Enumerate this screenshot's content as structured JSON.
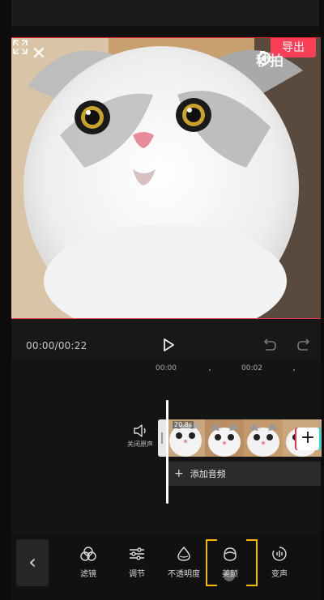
{
  "player": {
    "export_label": "导出",
    "watermark_text": "秒拍",
    "timecode": "00:00/00:22"
  },
  "timeline": {
    "ruler_labels": [
      "00:00",
      "00:02"
    ],
    "clip_duration": "20.8s",
    "mute_label": "关闭原声",
    "add_audio_label": "添加音频"
  },
  "toolbar": {
    "items": [
      {
        "label": "滤镜",
        "icon": "filter-icon"
      },
      {
        "label": "调节",
        "icon": "adjust-icon"
      },
      {
        "label": "不透明度",
        "icon": "opacity-icon"
      },
      {
        "label": "美颜",
        "icon": "beauty-icon"
      },
      {
        "label": "变声",
        "icon": "voice-change-icon"
      }
    ]
  },
  "colors": {
    "accent": "#fc3e57",
    "selection": "#f5b700",
    "background": "#161616"
  }
}
